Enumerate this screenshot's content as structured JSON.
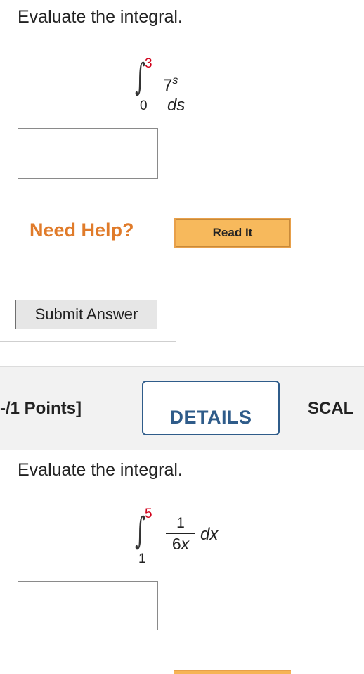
{
  "question1": {
    "prompt": "Evaluate the integral.",
    "integral": {
      "sign": "∫",
      "upper": "3",
      "lower": "0",
      "base": "7",
      "exponent": "s",
      "differential": "ds"
    },
    "answer_value": ""
  },
  "help": {
    "label": "Need Help?",
    "read_button": "Read It"
  },
  "submit_button": "Submit Answer",
  "question2_header": {
    "points": "-/1 Points]",
    "details_button": "DETAILS",
    "scale_text": "SCAL"
  },
  "question2": {
    "prompt": "Evaluate the integral.",
    "integral": {
      "sign": "∫",
      "upper": "5",
      "lower": "1",
      "numerator": "1",
      "denominator_coef": "6",
      "denominator_var": "x",
      "differential": "dx"
    },
    "answer_value": ""
  },
  "colors": {
    "limit_upper": "#d0021b",
    "need_help": "#e07b2a",
    "read_button": "#f6b455",
    "details_border": "#2f5c8a",
    "band": "#f2f2f2"
  }
}
